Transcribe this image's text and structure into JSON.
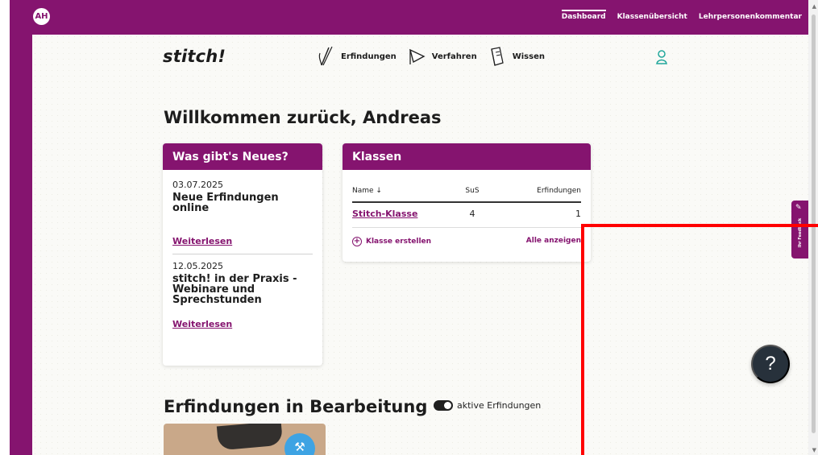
{
  "topbar": {
    "avatar": "AH",
    "links": [
      "Dashboard",
      "Klassenübersicht",
      "Lehrpersonenkommentar"
    ]
  },
  "brand": {
    "name": "stitch!"
  },
  "main_nav": {
    "items": [
      "Erfindungen",
      "Verfahren",
      "Wissen"
    ]
  },
  "page": {
    "welcome": "Willkommen zurück, Andreas"
  },
  "news": {
    "title": "Was gibt's Neues?",
    "items": [
      {
        "date": "03.07.2025",
        "title": "Neue Erfindungen online",
        "link": "Weiterlesen"
      },
      {
        "date": "12.05.2025",
        "title": "stitch! in der Praxis - Webinare und Sprechstunden",
        "link": "Weiterlesen"
      }
    ]
  },
  "classes": {
    "title": "Klassen",
    "columns": [
      "Name ↓",
      "SuS",
      "Erfindungen"
    ],
    "rows": [
      {
        "name": "Stitch-Klasse",
        "sus": "4",
        "erfindungen": "1"
      }
    ],
    "create": "Klasse erstellen",
    "all": "Alle anzeigen"
  },
  "projects": {
    "title": "Erfindungen in Bearbeitung",
    "toggle_label": "aktive Erfindungen"
  },
  "feedback": {
    "text": "Ihr Feedback"
  },
  "help": {
    "label": "?"
  },
  "colors": {
    "brand": "#85146f",
    "accent": "#3ea3e3",
    "highlight": "#ff0000"
  }
}
